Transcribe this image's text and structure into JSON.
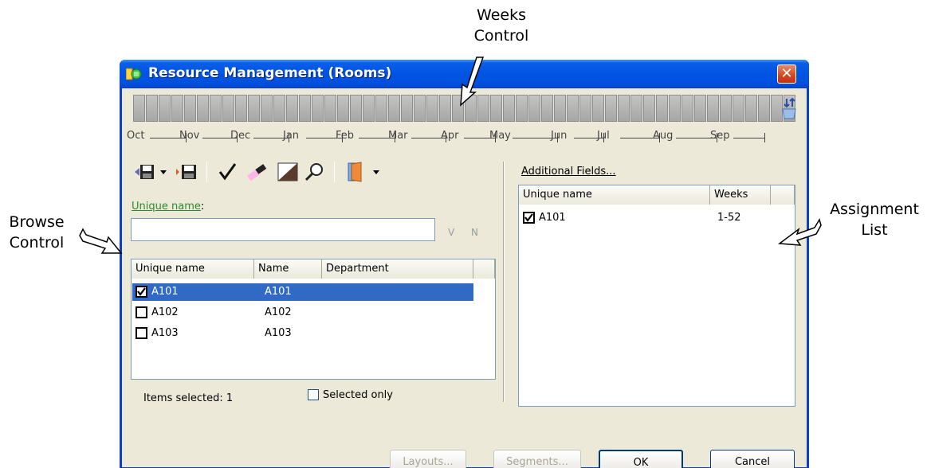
{
  "callouts": {
    "weeks_control": [
      "Weeks",
      "Control"
    ],
    "browse_control": [
      "Browse",
      "Control"
    ],
    "assignment_list": [
      "Assignment",
      "List"
    ]
  },
  "window": {
    "title": "Resource Management (Rooms)",
    "close_glyph": "✕"
  },
  "weeks": {
    "count": 52,
    "months": [
      "Oct",
      "Nov",
      "Dec",
      "Jan",
      "Feb",
      "Mar",
      "Apr",
      "May",
      "Jun",
      "Jul",
      "Aug",
      "Sep"
    ]
  },
  "toolbar": {
    "icons": [
      "save-icon",
      "dropdown-arrow-icon",
      "save-as-icon",
      "check-icon",
      "eraser-icon",
      "shade-icon",
      "magnifier-icon",
      "door-icon",
      "dropdown-arrow-icon"
    ]
  },
  "browse": {
    "field_label": "Unique name",
    "field_label_suffix": ":",
    "search_value": "",
    "v_label": "V",
    "n_label": "N",
    "columns": [
      "Unique name",
      "Name",
      "Department"
    ],
    "rows": [
      {
        "checked": true,
        "unique_name": "A101",
        "name": "A101",
        "department": "",
        "selected": true
      },
      {
        "checked": false,
        "unique_name": "A102",
        "name": "A102",
        "department": "",
        "selected": false
      },
      {
        "checked": false,
        "unique_name": "A103",
        "name": "A103",
        "department": "",
        "selected": false
      }
    ],
    "items_selected": "Items selected: 1",
    "selected_only_label": "Selected only",
    "selected_only_checked": false
  },
  "assignment": {
    "additional_fields": "Additional Fields...",
    "columns": [
      "Unique name",
      "Weeks"
    ],
    "rows": [
      {
        "checked": true,
        "unique_name": "A101",
        "weeks": "1-52"
      }
    ]
  },
  "buttons": {
    "layouts": "Layouts...",
    "segments": "Segments...",
    "ok": "OK",
    "cancel": "Cancel"
  },
  "colors": {
    "titlebar": "#0054e3",
    "selection": "#316ac5",
    "dialog_bg": "#ece9d8",
    "label_green": "#2f8a2f"
  }
}
